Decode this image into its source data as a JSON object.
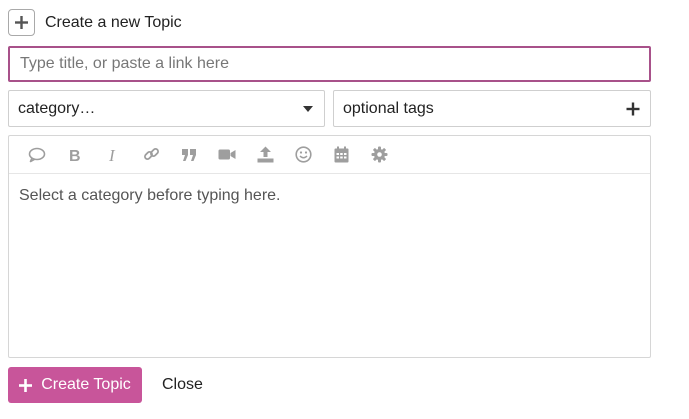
{
  "header": {
    "title": "Create a new Topic",
    "icon": "plus-icon"
  },
  "title_input": {
    "value": "",
    "placeholder": "Type title, or paste a link here"
  },
  "category": {
    "selected": "category…",
    "icon": "caret-down-icon"
  },
  "tags": {
    "placeholder": "optional tags",
    "icon": "plus-icon"
  },
  "toolbar": {
    "buttons": [
      {
        "name": "quote-bubble-icon"
      },
      {
        "name": "bold-icon"
      },
      {
        "name": "italic-icon"
      },
      {
        "name": "link-icon"
      },
      {
        "name": "blockquote-icon"
      },
      {
        "name": "video-icon"
      },
      {
        "name": "upload-icon"
      },
      {
        "name": "emoji-icon"
      },
      {
        "name": "calendar-icon"
      },
      {
        "name": "gear-icon"
      }
    ]
  },
  "editor": {
    "placeholder": "Select a category before typing here."
  },
  "footer": {
    "create_label": "Create Topic",
    "close_label": "Close"
  },
  "colors": {
    "accent": "#c8559a",
    "focus_border": "#a8518a",
    "icon_gray": "#9e9e9e"
  }
}
